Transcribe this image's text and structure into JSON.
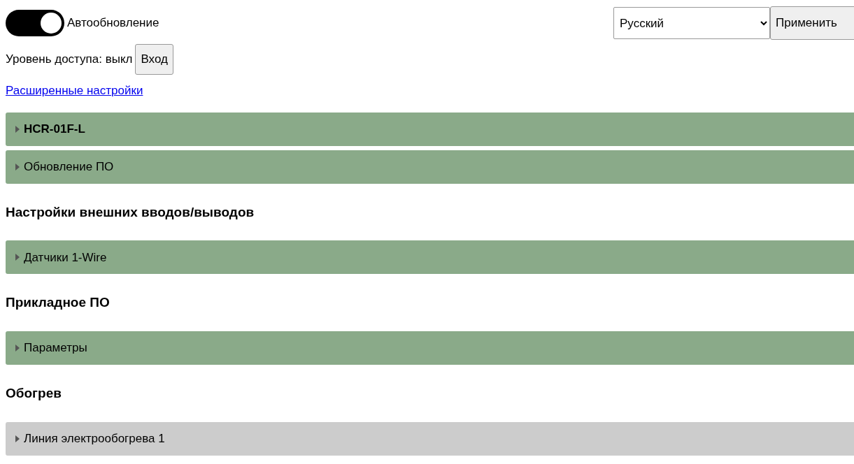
{
  "auto_update": {
    "label": "Автообновление",
    "on": true
  },
  "language": {
    "value": "Русский",
    "apply_button": "Применить"
  },
  "access": {
    "text": "Уровень доступа: выкл",
    "login_button": "Вход"
  },
  "advanced_link": "Расширенные настройки",
  "sections": [
    {
      "kind": "panel",
      "title": "HCR-01F-L",
      "bold": true,
      "expanded": false,
      "color": "#8aaa89"
    },
    {
      "kind": "panel",
      "title": "Обновление ПО",
      "bold": false,
      "expanded": false,
      "color": "#8aaa89"
    },
    {
      "kind": "heading",
      "title": "Настройки внешних вводов/выводов"
    },
    {
      "kind": "panel",
      "title": "Датчики 1-Wire",
      "bold": false,
      "expanded": false,
      "color": "#8aaa89"
    },
    {
      "kind": "heading",
      "title": "Прикладное ПО"
    },
    {
      "kind": "panel",
      "title": "Параметры",
      "bold": false,
      "expanded": false,
      "color": "#8aaa89"
    },
    {
      "kind": "heading",
      "title": "Обогрев"
    },
    {
      "kind": "panel",
      "title": "Линия электрообогрева 1",
      "bold": false,
      "expanded": false,
      "color": "#cccccc"
    }
  ]
}
